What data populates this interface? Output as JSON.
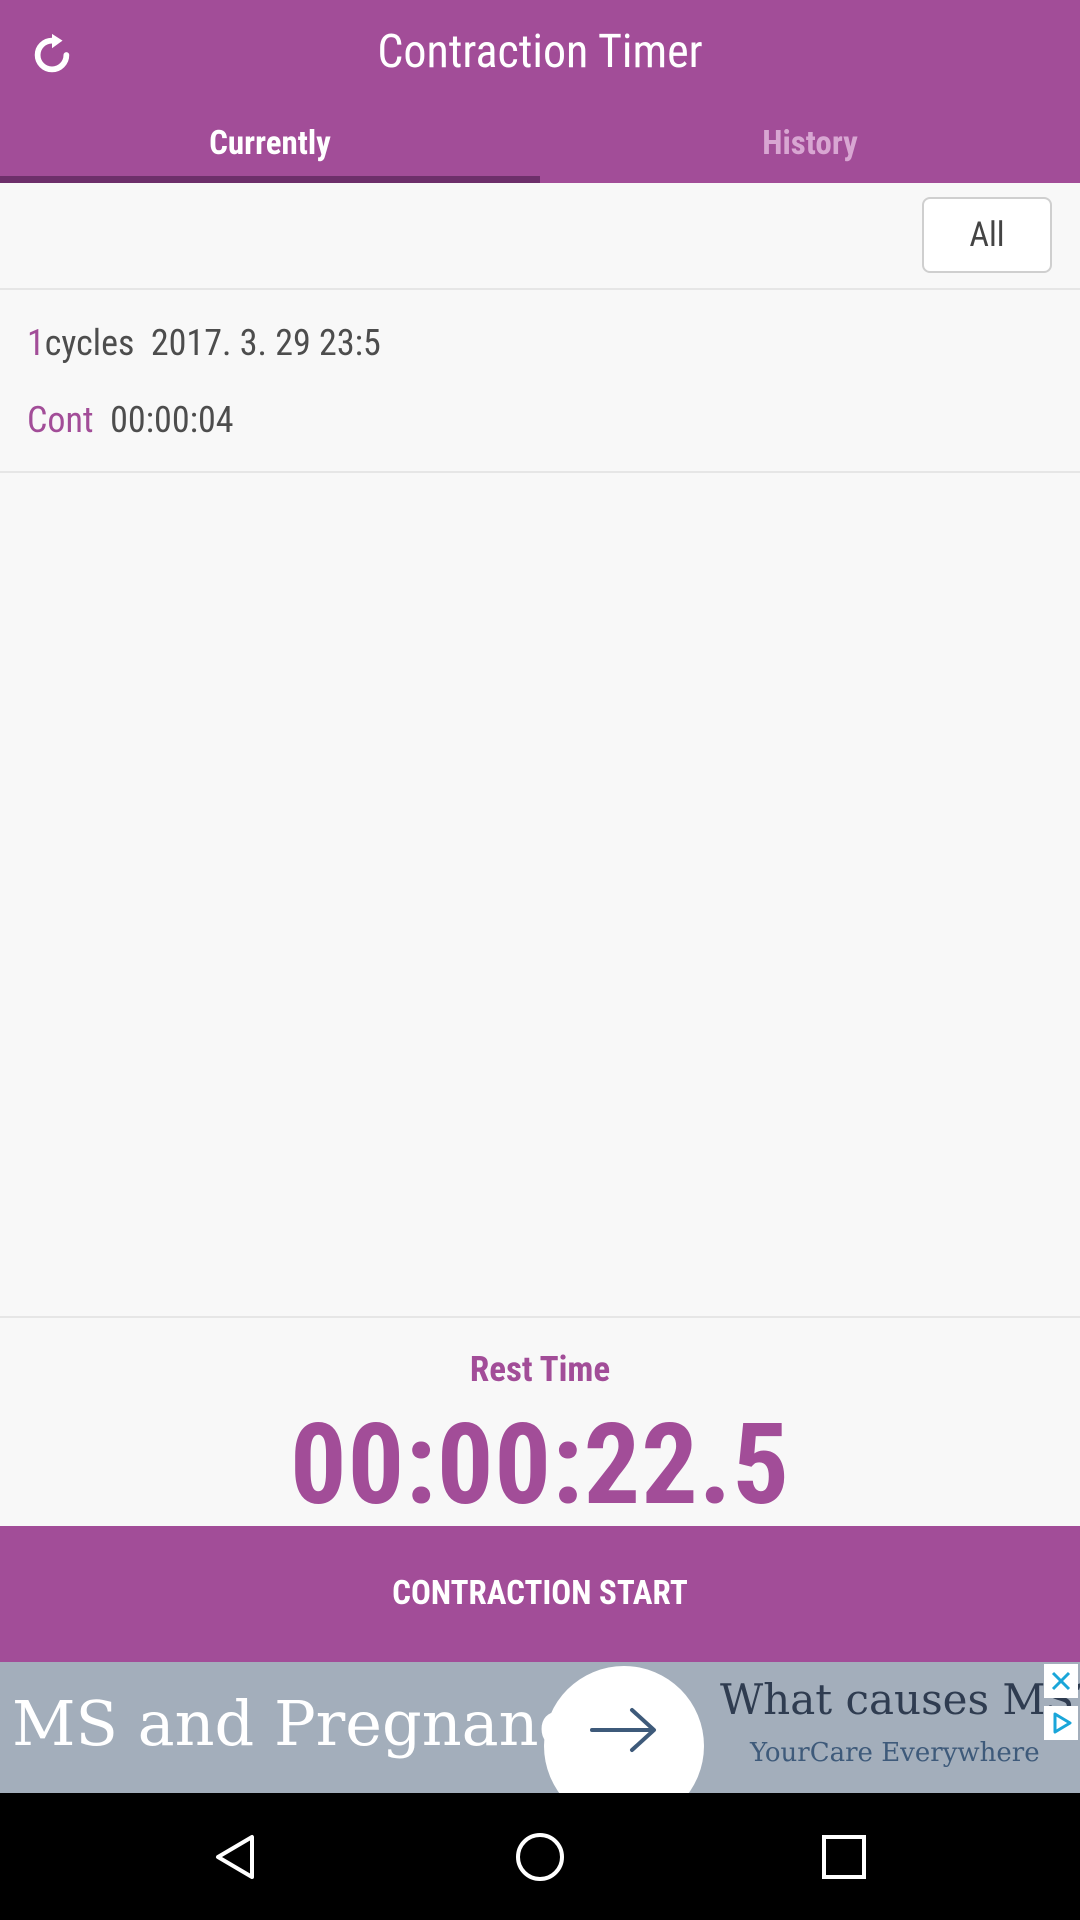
{
  "app": {
    "title": "Contraction Timer",
    "refresh_icon": "refresh-icon",
    "colors": {
      "primary": "#a24d98",
      "tab_indicator": "#6d2f6a",
      "inactive_tab": "#d8a6d2"
    }
  },
  "tabs": [
    {
      "label": "Currently",
      "active": true
    },
    {
      "label": "History",
      "active": false
    }
  ],
  "filter": {
    "label": "All"
  },
  "cycles": [
    {
      "count": "1",
      "unit": "cycles",
      "timestamp": "2017. 3. 29 23:5",
      "cont_label": "Cont",
      "duration": "00:00:04"
    }
  ],
  "rest": {
    "label": "Rest Time",
    "time": "00:00:22.5"
  },
  "action": {
    "label": "CONTRACTION START"
  },
  "ad": {
    "title": "MS and Pregnancy",
    "headline": "What causes MS?",
    "subtext": "YourCare Everywhere",
    "close_icon": "close-icon",
    "choices_icon": "ad-choices-icon",
    "arrow_icon": "arrow-right-icon"
  },
  "navigation": {
    "icons": [
      "back-icon",
      "home-icon",
      "recents-icon"
    ]
  }
}
